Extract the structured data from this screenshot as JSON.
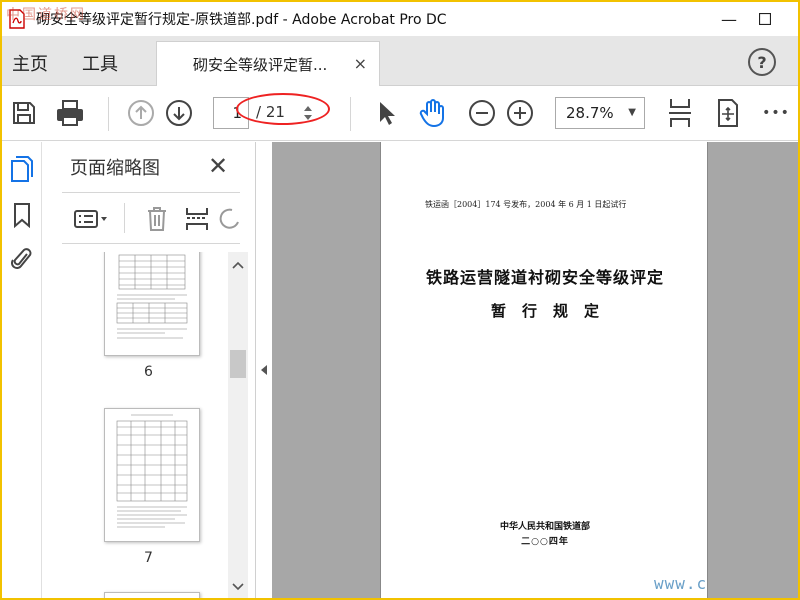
{
  "window": {
    "title": "砌安全等级评定暂行规定-原铁道部.pdf - Adobe Acrobat Pro DC",
    "controls": {
      "minimize": "—",
      "maximize": "☐"
    }
  },
  "menu": {
    "home": "主页",
    "tools": "工具"
  },
  "tab": {
    "label": "砌安全等级评定暂...",
    "close": "×"
  },
  "help": "?",
  "toolbar": {
    "current_page": "1",
    "total_pages": "/ 21",
    "zoom": "28.7%",
    "more": "•••"
  },
  "panel": {
    "title": "页面缩略图",
    "close": "✕",
    "thumbnails": [
      {
        "label": "6"
      },
      {
        "label": "7"
      }
    ]
  },
  "document": {
    "header_line": "铁运函［2004］174 号发布，2004 年 6 月 1 日起试行",
    "title_line1": "铁路运营隧道衬砌安全等级评定",
    "title_line2": "暂行规定",
    "issuer": "中华人民共和国铁道部",
    "year": "二○○四年"
  },
  "watermarks": {
    "top_left": "中国道桥网",
    "bottom_right": "www.c"
  },
  "colors": {
    "accent_blue": "#1473e6",
    "oval_red": "#e22222",
    "doc_background": "#a7a7a7"
  }
}
